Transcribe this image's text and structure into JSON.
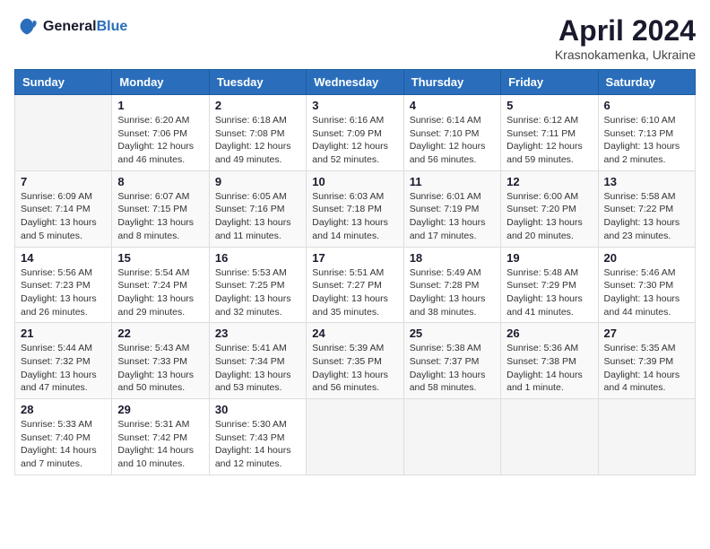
{
  "header": {
    "logo_line1": "General",
    "logo_line2": "Blue",
    "month_year": "April 2024",
    "location": "Krasnokamenka, Ukraine"
  },
  "columns": [
    "Sunday",
    "Monday",
    "Tuesday",
    "Wednesday",
    "Thursday",
    "Friday",
    "Saturday"
  ],
  "weeks": [
    [
      {
        "day": "",
        "sunrise": "",
        "sunset": "",
        "daylight": ""
      },
      {
        "day": "1",
        "sunrise": "Sunrise: 6:20 AM",
        "sunset": "Sunset: 7:06 PM",
        "daylight": "Daylight: 12 hours and 46 minutes."
      },
      {
        "day": "2",
        "sunrise": "Sunrise: 6:18 AM",
        "sunset": "Sunset: 7:08 PM",
        "daylight": "Daylight: 12 hours and 49 minutes."
      },
      {
        "day": "3",
        "sunrise": "Sunrise: 6:16 AM",
        "sunset": "Sunset: 7:09 PM",
        "daylight": "Daylight: 12 hours and 52 minutes."
      },
      {
        "day": "4",
        "sunrise": "Sunrise: 6:14 AM",
        "sunset": "Sunset: 7:10 PM",
        "daylight": "Daylight: 12 hours and 56 minutes."
      },
      {
        "day": "5",
        "sunrise": "Sunrise: 6:12 AM",
        "sunset": "Sunset: 7:11 PM",
        "daylight": "Daylight: 12 hours and 59 minutes."
      },
      {
        "day": "6",
        "sunrise": "Sunrise: 6:10 AM",
        "sunset": "Sunset: 7:13 PM",
        "daylight": "Daylight: 13 hours and 2 minutes."
      }
    ],
    [
      {
        "day": "7",
        "sunrise": "Sunrise: 6:09 AM",
        "sunset": "Sunset: 7:14 PM",
        "daylight": "Daylight: 13 hours and 5 minutes."
      },
      {
        "day": "8",
        "sunrise": "Sunrise: 6:07 AM",
        "sunset": "Sunset: 7:15 PM",
        "daylight": "Daylight: 13 hours and 8 minutes."
      },
      {
        "day": "9",
        "sunrise": "Sunrise: 6:05 AM",
        "sunset": "Sunset: 7:16 PM",
        "daylight": "Daylight: 13 hours and 11 minutes."
      },
      {
        "day": "10",
        "sunrise": "Sunrise: 6:03 AM",
        "sunset": "Sunset: 7:18 PM",
        "daylight": "Daylight: 13 hours and 14 minutes."
      },
      {
        "day": "11",
        "sunrise": "Sunrise: 6:01 AM",
        "sunset": "Sunset: 7:19 PM",
        "daylight": "Daylight: 13 hours and 17 minutes."
      },
      {
        "day": "12",
        "sunrise": "Sunrise: 6:00 AM",
        "sunset": "Sunset: 7:20 PM",
        "daylight": "Daylight: 13 hours and 20 minutes."
      },
      {
        "day": "13",
        "sunrise": "Sunrise: 5:58 AM",
        "sunset": "Sunset: 7:22 PM",
        "daylight": "Daylight: 13 hours and 23 minutes."
      }
    ],
    [
      {
        "day": "14",
        "sunrise": "Sunrise: 5:56 AM",
        "sunset": "Sunset: 7:23 PM",
        "daylight": "Daylight: 13 hours and 26 minutes."
      },
      {
        "day": "15",
        "sunrise": "Sunrise: 5:54 AM",
        "sunset": "Sunset: 7:24 PM",
        "daylight": "Daylight: 13 hours and 29 minutes."
      },
      {
        "day": "16",
        "sunrise": "Sunrise: 5:53 AM",
        "sunset": "Sunset: 7:25 PM",
        "daylight": "Daylight: 13 hours and 32 minutes."
      },
      {
        "day": "17",
        "sunrise": "Sunrise: 5:51 AM",
        "sunset": "Sunset: 7:27 PM",
        "daylight": "Daylight: 13 hours and 35 minutes."
      },
      {
        "day": "18",
        "sunrise": "Sunrise: 5:49 AM",
        "sunset": "Sunset: 7:28 PM",
        "daylight": "Daylight: 13 hours and 38 minutes."
      },
      {
        "day": "19",
        "sunrise": "Sunrise: 5:48 AM",
        "sunset": "Sunset: 7:29 PM",
        "daylight": "Daylight: 13 hours and 41 minutes."
      },
      {
        "day": "20",
        "sunrise": "Sunrise: 5:46 AM",
        "sunset": "Sunset: 7:30 PM",
        "daylight": "Daylight: 13 hours and 44 minutes."
      }
    ],
    [
      {
        "day": "21",
        "sunrise": "Sunrise: 5:44 AM",
        "sunset": "Sunset: 7:32 PM",
        "daylight": "Daylight: 13 hours and 47 minutes."
      },
      {
        "day": "22",
        "sunrise": "Sunrise: 5:43 AM",
        "sunset": "Sunset: 7:33 PM",
        "daylight": "Daylight: 13 hours and 50 minutes."
      },
      {
        "day": "23",
        "sunrise": "Sunrise: 5:41 AM",
        "sunset": "Sunset: 7:34 PM",
        "daylight": "Daylight: 13 hours and 53 minutes."
      },
      {
        "day": "24",
        "sunrise": "Sunrise: 5:39 AM",
        "sunset": "Sunset: 7:35 PM",
        "daylight": "Daylight: 13 hours and 56 minutes."
      },
      {
        "day": "25",
        "sunrise": "Sunrise: 5:38 AM",
        "sunset": "Sunset: 7:37 PM",
        "daylight": "Daylight: 13 hours and 58 minutes."
      },
      {
        "day": "26",
        "sunrise": "Sunrise: 5:36 AM",
        "sunset": "Sunset: 7:38 PM",
        "daylight": "Daylight: 14 hours and 1 minute."
      },
      {
        "day": "27",
        "sunrise": "Sunrise: 5:35 AM",
        "sunset": "Sunset: 7:39 PM",
        "daylight": "Daylight: 14 hours and 4 minutes."
      }
    ],
    [
      {
        "day": "28",
        "sunrise": "Sunrise: 5:33 AM",
        "sunset": "Sunset: 7:40 PM",
        "daylight": "Daylight: 14 hours and 7 minutes."
      },
      {
        "day": "29",
        "sunrise": "Sunrise: 5:31 AM",
        "sunset": "Sunset: 7:42 PM",
        "daylight": "Daylight: 14 hours and 10 minutes."
      },
      {
        "day": "30",
        "sunrise": "Sunrise: 5:30 AM",
        "sunset": "Sunset: 7:43 PM",
        "daylight": "Daylight: 14 hours and 12 minutes."
      },
      {
        "day": "",
        "sunrise": "",
        "sunset": "",
        "daylight": ""
      },
      {
        "day": "",
        "sunrise": "",
        "sunset": "",
        "daylight": ""
      },
      {
        "day": "",
        "sunrise": "",
        "sunset": "",
        "daylight": ""
      },
      {
        "day": "",
        "sunrise": "",
        "sunset": "",
        "daylight": ""
      }
    ]
  ]
}
